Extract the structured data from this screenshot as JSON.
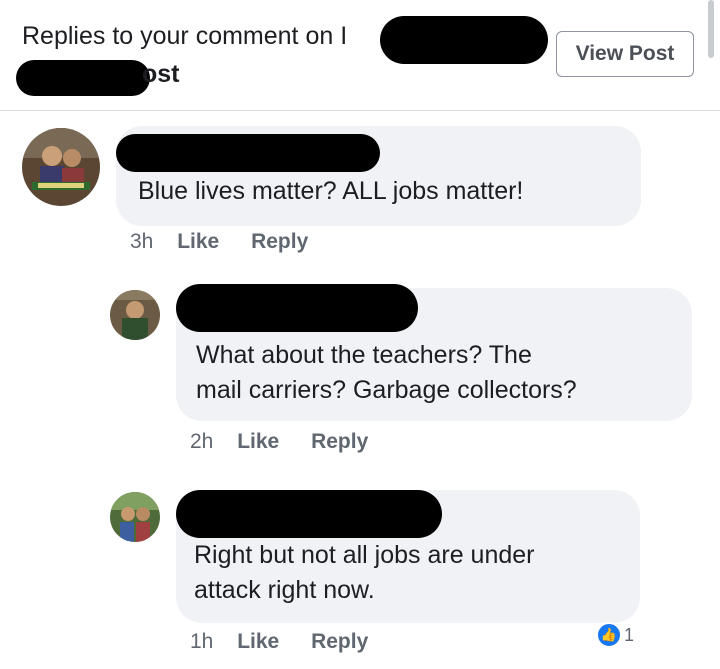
{
  "header": {
    "title_prefix": "Replies to your comment on",
    "title_cut_char": "I",
    "title_suffix": "ost",
    "view_post_label": "View Post"
  },
  "comments": [
    {
      "text": "Blue lives matter? ALL jobs matter!",
      "time": "3h",
      "like_label": "Like",
      "reply_label": "Reply"
    },
    {
      "text_line1": "What about the teachers? The",
      "text_line2": "mail carriers? Garbage collectors?",
      "time": "2h",
      "like_label": "Like",
      "reply_label": "Reply"
    },
    {
      "text_line1": "Right but not all jobs are under",
      "text_line2": "attack right now.",
      "time": "1h",
      "like_label": "Like",
      "reply_label": "Reply",
      "reaction_icon": "like-thumb-icon",
      "reaction_count": "1"
    }
  ],
  "colors": {
    "bubble": "#f0f2f5",
    "action_text": "#606770",
    "like_blue": "#1877f2"
  }
}
